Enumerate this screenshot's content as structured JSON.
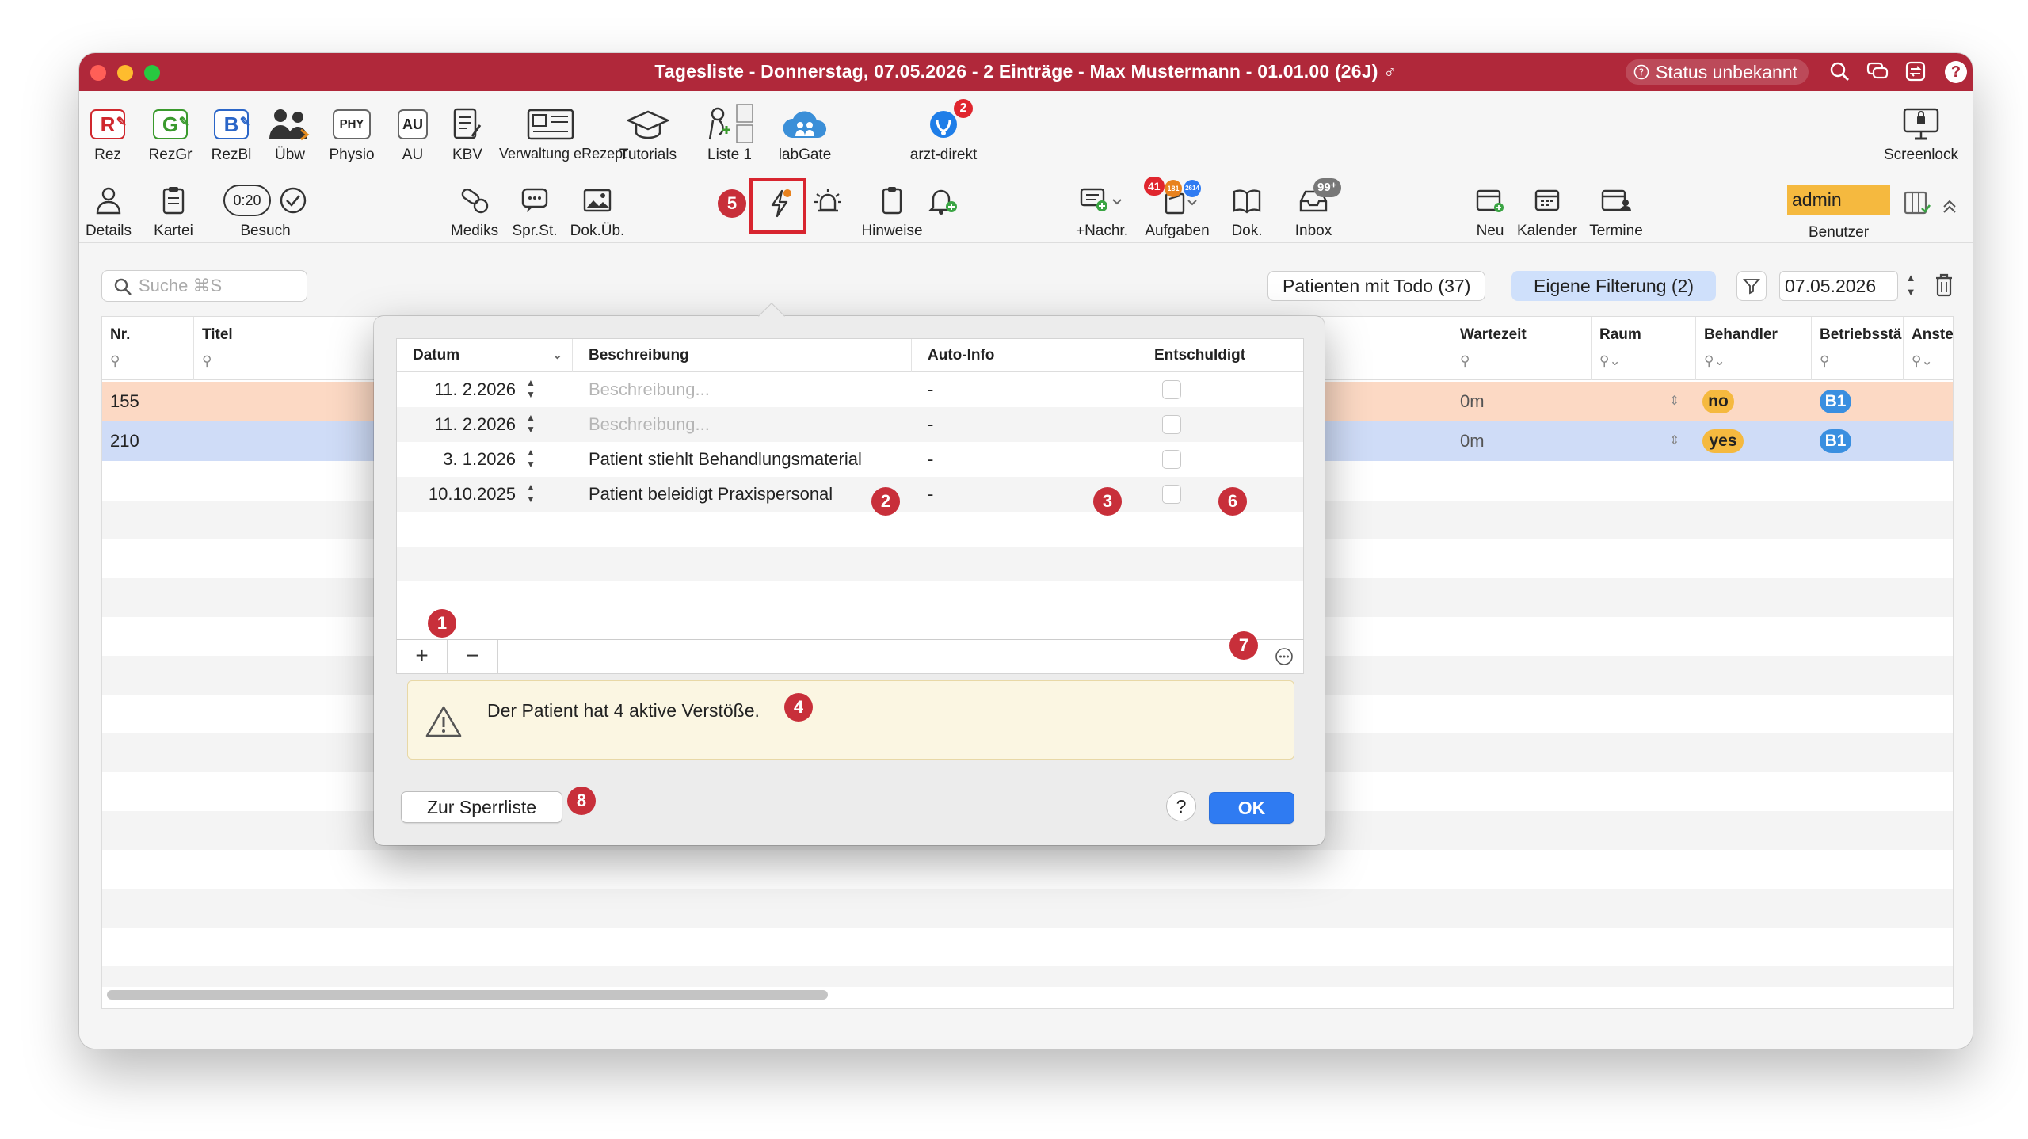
{
  "window": {
    "title": "Tagesliste - Donnerstag, 07.05.2026 - 2 Einträge - Max Mustermann - 01.01.00 (26J) ♂",
    "status": "Status unbekannt",
    "colors": {
      "titlebar": "#b0283a",
      "accent": "#2f7bf2",
      "marker": "#c82f3a",
      "warn_bg": "#fbf6e2"
    }
  },
  "toolbar1": {
    "items": [
      {
        "label": "Rez",
        "icon": "rez-form-icon"
      },
      {
        "label": "RezGr",
        "icon": "rezgr-form-icon"
      },
      {
        "label": "RezBl",
        "icon": "rezbl-form-icon"
      },
      {
        "label": "Übw",
        "icon": "referral-people-icon"
      },
      {
        "label": "Physio",
        "icon": "physio-form-icon"
      },
      {
        "label": "AU",
        "icon": "au-form-icon"
      },
      {
        "label": "KBV",
        "icon": "kbv-document-icon"
      },
      {
        "label": "Verwaltung eRezept",
        "icon": "erezept-icon"
      },
      {
        "label": "Tutorials",
        "icon": "graduation-cap-icon"
      },
      {
        "label": "Liste 1",
        "icon": "list-icon"
      },
      {
        "label": "labGate",
        "icon": "cloud-people-icon"
      },
      {
        "label": "arzt-direkt",
        "icon": "arzt-direkt-icon",
        "badge": "2"
      }
    ],
    "screenlock": "Screenlock"
  },
  "toolbar2": {
    "details": "Details",
    "kartei": "Kartei",
    "besuch": "Besuch",
    "timer": "0:20",
    "mediks": "Mediks",
    "sprst": "Spr.St.",
    "dokueb": "Dok.Üb.",
    "hinweise": "Hinweise",
    "nachr": "+Nachr.",
    "aufgaben": "Aufgaben",
    "aufgaben_badges": [
      "41",
      "181",
      "2614"
    ],
    "dok": "Dok.",
    "inbox": "Inbox",
    "inbox_badge": "99⁺",
    "neu": "Neu",
    "kalender": "Kalender",
    "termine": "Termine",
    "user": "admin",
    "benutzer": "Benutzer"
  },
  "filters": {
    "search_placeholder": "Suche ⌘S",
    "todo": "Patienten mit Todo (37)",
    "own_filter": "Eigene Filterung (2)",
    "date": "07.05.2026"
  },
  "grid": {
    "columns": [
      "Nr.",
      "Titel",
      "Wartezeit",
      "Raum",
      "Behandler",
      "Betriebsstä",
      "Anste"
    ],
    "rows": [
      {
        "nr": "155",
        "wartezeit": "0m",
        "behandler": "no",
        "betrieb": "B1",
        "color": "#fcd9c4"
      },
      {
        "nr": "210",
        "wartezeit": "0m",
        "behandler": "yes",
        "betrieb": "B1",
        "color": "#cfdcf7"
      }
    ]
  },
  "dialog": {
    "columns": [
      "Datum",
      "Beschreibung",
      "Auto-Info",
      "Entschuldigt"
    ],
    "rows": [
      {
        "datum": "11.  2.2026",
        "beschreibung": "Beschreibung...",
        "placeholder": true,
        "autoinfo": "-"
      },
      {
        "datum": "11.  2.2026",
        "beschreibung": "Beschreibung...",
        "placeholder": true,
        "autoinfo": "-"
      },
      {
        "datum": "3.  1.2026",
        "beschreibung": "Patient stiehlt Behandlungsmaterial",
        "placeholder": false,
        "autoinfo": "-"
      },
      {
        "datum": "10.10.2025",
        "beschreibung": "Patient beleidigt Praxispersonal",
        "placeholder": false,
        "autoinfo": "-"
      }
    ],
    "add": "+",
    "remove": "−",
    "warning": "Der Patient hat 4 aktive Verstöße.",
    "sperrliste": "Zur Sperrliste",
    "help": "?",
    "ok": "OK"
  },
  "markers": [
    "1",
    "2",
    "3",
    "4",
    "5",
    "6",
    "7",
    "8"
  ]
}
